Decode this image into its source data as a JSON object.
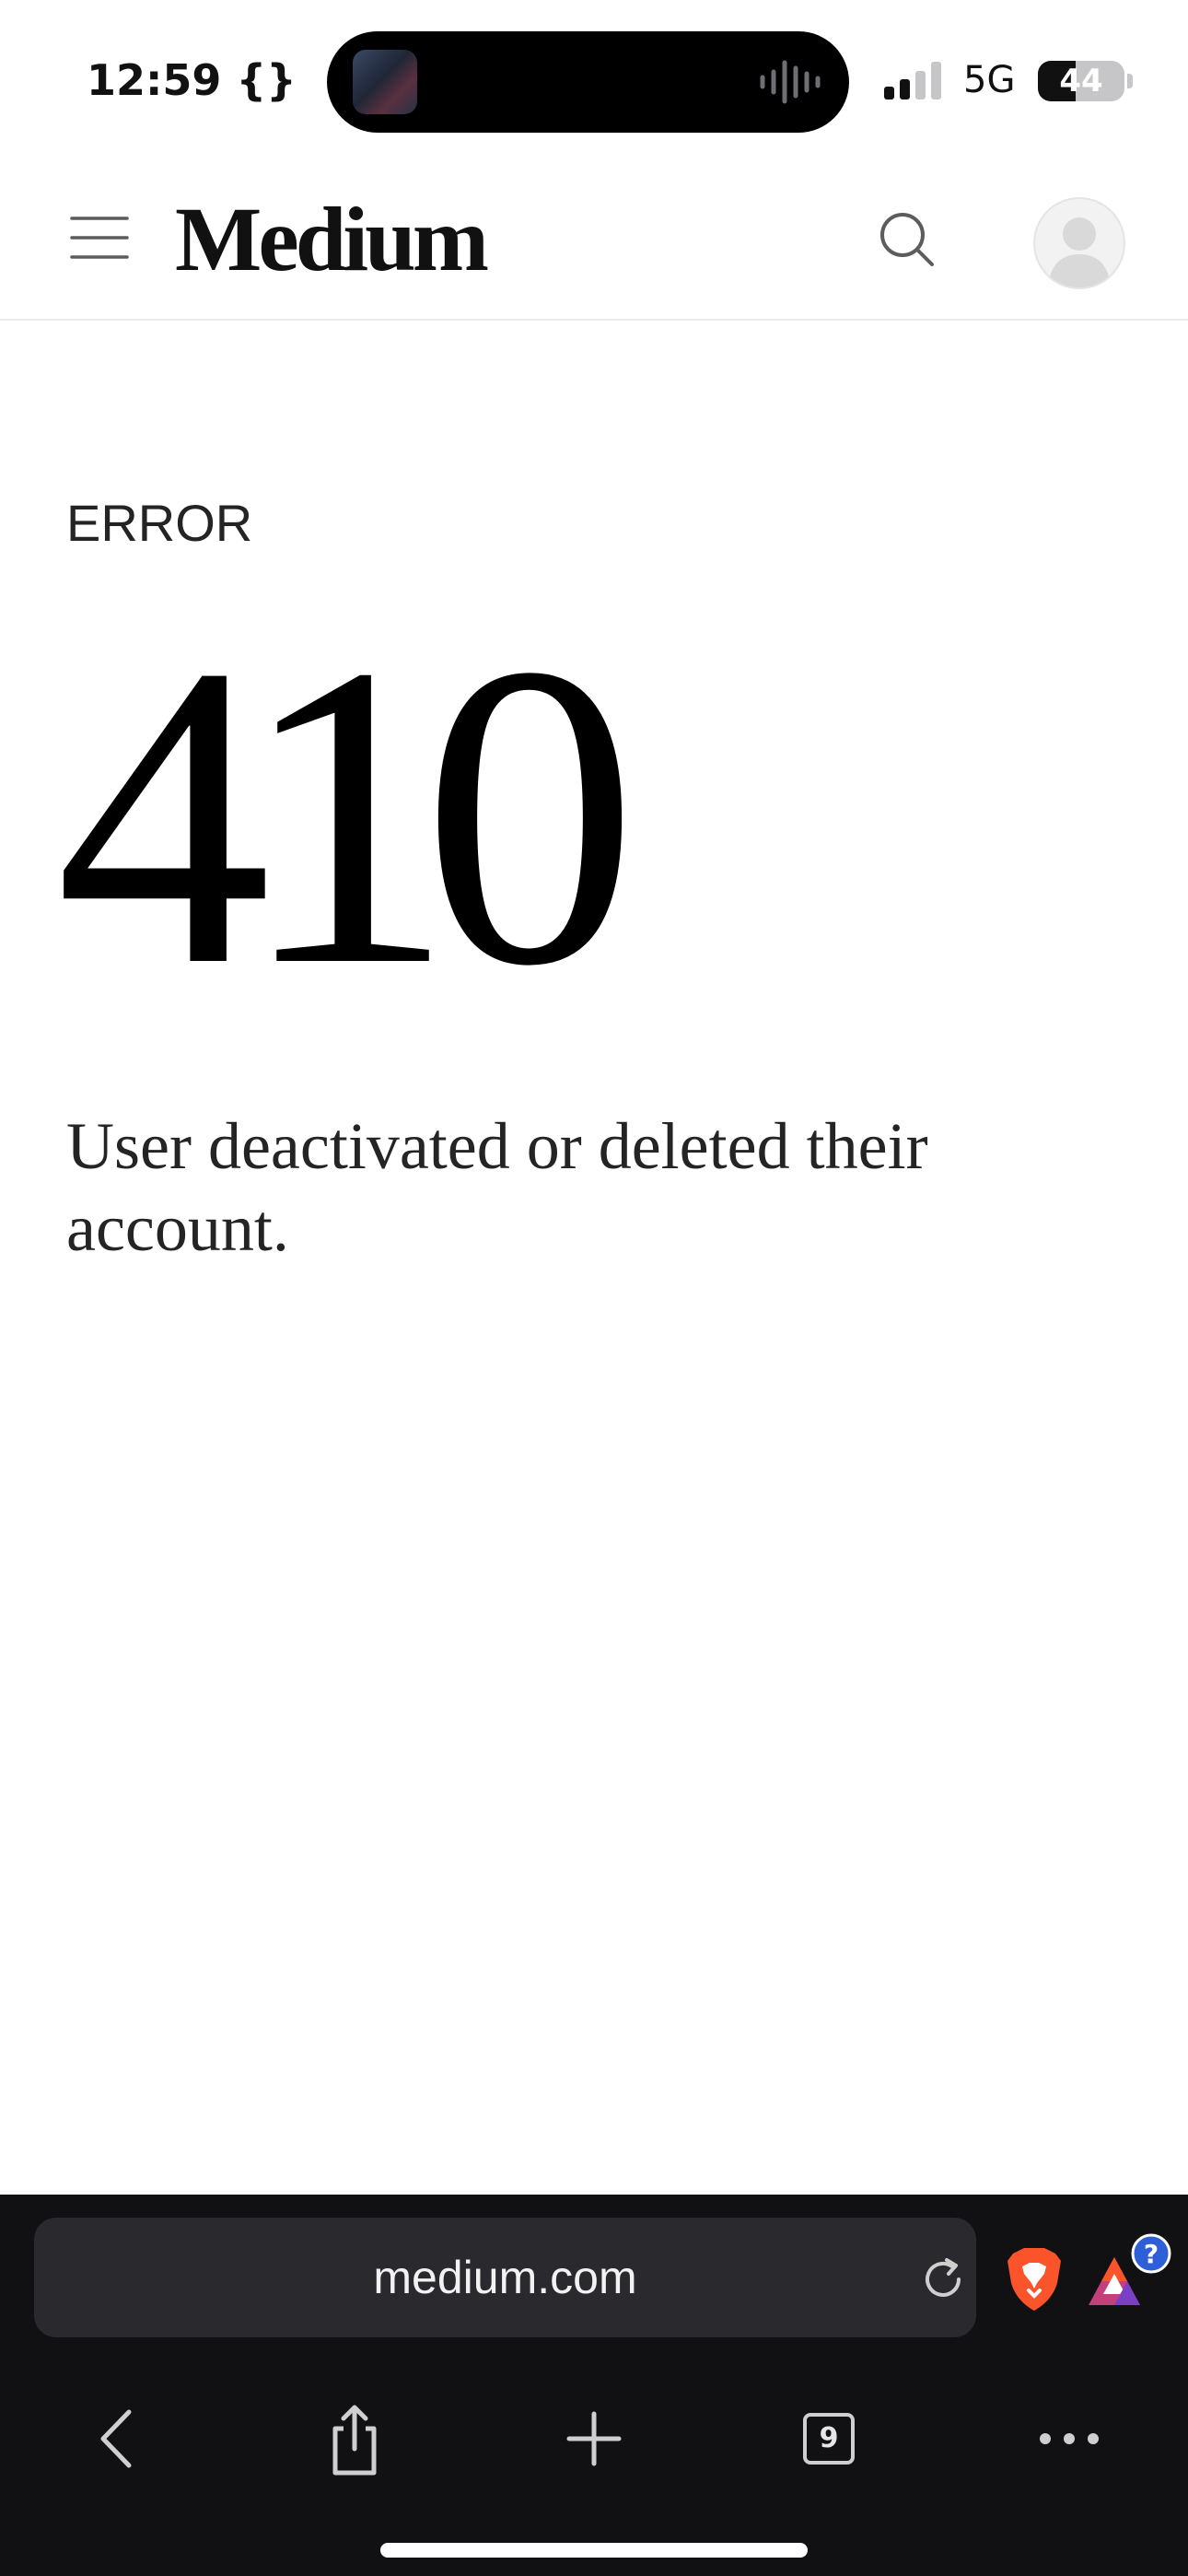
{
  "status_bar": {
    "time": "12:59 {}",
    "network": "5G",
    "battery_level": "44",
    "battery_fraction": 0.44
  },
  "header": {
    "logo_text": "Medium",
    "icons": [
      "menu-icon",
      "search-icon",
      "avatar-icon"
    ]
  },
  "main": {
    "error_label": "ERROR",
    "error_code": "410",
    "message": "User deactivated or deleted their account."
  },
  "browser": {
    "url": "medium.com",
    "tab_count": "9",
    "toolbar_icons": [
      "back-icon",
      "share-icon",
      "new-tab-icon",
      "tabs-icon",
      "more-icon"
    ],
    "rewards_badge": "?",
    "colors": {
      "bar_background": "#111114",
      "url_field": "#2a2a2e",
      "brave_orange": "#fb542b",
      "badge_blue": "#2f5fd8"
    }
  }
}
